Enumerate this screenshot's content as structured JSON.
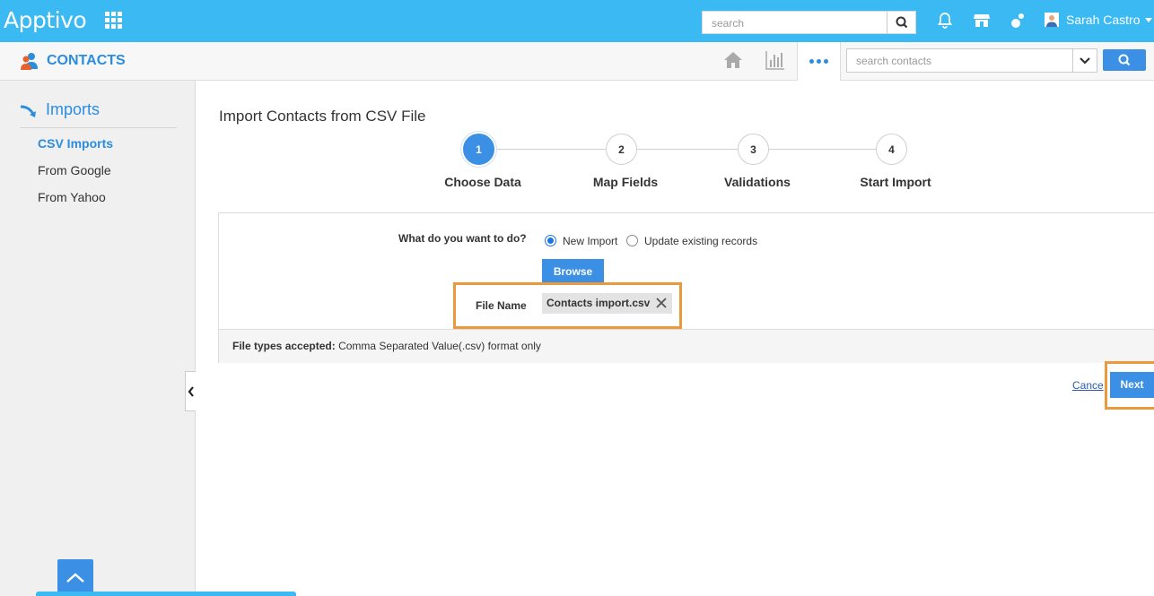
{
  "header": {
    "logo": "Apptivo",
    "search_placeholder": "search",
    "user_name": "Sarah Castro"
  },
  "subbar": {
    "app_name": "CONTACTS",
    "search_placeholder": "search contacts"
  },
  "sidebar": {
    "section_title": "Imports",
    "items": [
      {
        "label": "CSV Imports",
        "active": true
      },
      {
        "label": "From Google",
        "active": false
      },
      {
        "label": "From Yahoo",
        "active": false
      }
    ]
  },
  "main": {
    "title": "Import Contacts from CSV File",
    "steps": [
      {
        "number": "1",
        "label": "Choose Data",
        "active": true
      },
      {
        "number": "2",
        "label": "Map Fields",
        "active": false
      },
      {
        "number": "3",
        "label": "Validations",
        "active": false
      },
      {
        "number": "4",
        "label": "Start Import",
        "active": false
      }
    ],
    "question": "What do you want to do?",
    "options": [
      {
        "label": "New Import",
        "checked": true
      },
      {
        "label": "Update existing records",
        "checked": false
      }
    ],
    "browse_label": "Browse",
    "file_name_label": "File Name",
    "file_name_value": "Contacts import.csv",
    "accepted_label": "File types accepted:",
    "accepted_value": "Comma Separated Value(.csv) format only",
    "cancel_label": "Cance",
    "next_label": "Next"
  },
  "colors": {
    "topbar": "#3bb9f3",
    "accent": "#3b8fe5",
    "highlight": "#ea9a3d"
  }
}
